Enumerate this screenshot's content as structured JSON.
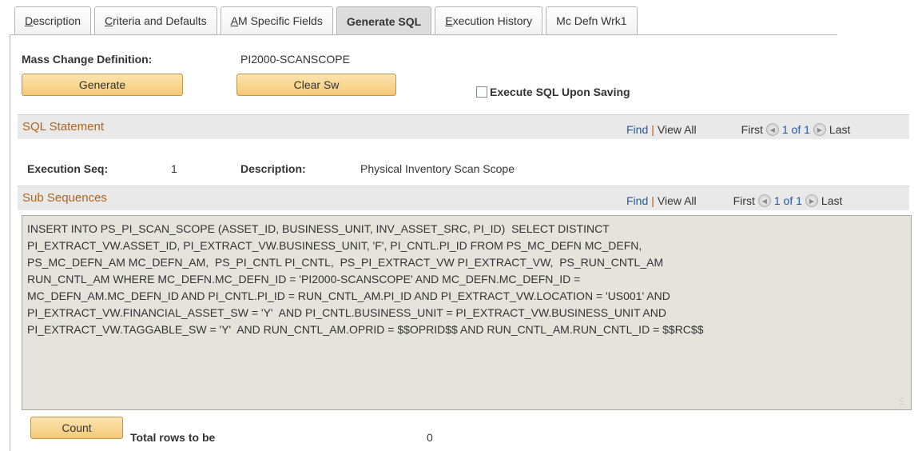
{
  "tabs": [
    {
      "pre": "",
      "u": "D",
      "post": "escription",
      "active": false
    },
    {
      "pre": "",
      "u": "C",
      "post": "riteria and Defaults",
      "active": false
    },
    {
      "pre": "",
      "u": "A",
      "post": "M Specific Fields",
      "active": false
    },
    {
      "pre": "Generate SQL",
      "u": "",
      "post": "",
      "active": true
    },
    {
      "pre": "",
      "u": "E",
      "post": "xecution History",
      "active": false
    },
    {
      "pre": "Mc Defn Wrk1",
      "u": "",
      "post": "",
      "active": false
    }
  ],
  "header": {
    "mass_change_label": "Mass Change Definition:",
    "mass_change_value": "PI2000-SCANSCOPE",
    "generate_button": "Generate",
    "clear_button": "Clear Sw",
    "execute_checkbox_label": "Execute SQL Upon Saving",
    "execute_checked": false
  },
  "sql_grid": {
    "title": "SQL Statement",
    "find": "Find",
    "sep": "|",
    "view_all": "View All",
    "first": "First",
    "range": "1 of 1",
    "last": "Last",
    "exec_seq_label": "Execution Seq:",
    "exec_seq_value": "1",
    "description_label": "Description:",
    "description_value": "Physical Inventory Scan Scope"
  },
  "sub_grid": {
    "title": "Sub Sequences",
    "find": "Find",
    "sep": "|",
    "view_all": "View All",
    "first": "First",
    "range": "1 of 1",
    "last": "Last",
    "sql_text": "INSERT INTO PS_PI_SCAN_SCOPE (ASSET_ID, BUSINESS_UNIT, INV_ASSET_SRC, PI_ID)  SELECT DISTINCT\nPI_EXTRACT_VW.ASSET_ID, PI_EXTRACT_VW.BUSINESS_UNIT, 'F', PI_CNTL.PI_ID FROM PS_MC_DEFN MC_DEFN,\nPS_MC_DEFN_AM MC_DEFN_AM,  PS_PI_CNTL PI_CNTL,  PS_PI_EXTRACT_VW PI_EXTRACT_VW,  PS_RUN_CNTL_AM\nRUN_CNTL_AM WHERE MC_DEFN.MC_DEFN_ID = 'PI2000-SCANSCOPE' AND MC_DEFN.MC_DEFN_ID =\nMC_DEFN_AM.MC_DEFN_ID AND PI_CNTL.PI_ID = RUN_CNTL_AM.PI_ID AND PI_EXTRACT_VW.LOCATION = 'US001' AND\nPI_EXTRACT_VW.FINANCIAL_ASSET_SW = 'Y'  AND PI_CNTL.BUSINESS_UNIT = PI_EXTRACT_VW.BUSINESS_UNIT AND\nPI_EXTRACT_VW.TAGGABLE_SW = 'Y'  AND RUN_CNTL_AM.OPRID = $$OPRID$$ AND RUN_CNTL_AM.RUN_CNTL_ID = $$RC$$"
  },
  "footer": {
    "count_button": "Count",
    "total_rows_label": "Total rows to be",
    "total_rows_value": "0"
  }
}
